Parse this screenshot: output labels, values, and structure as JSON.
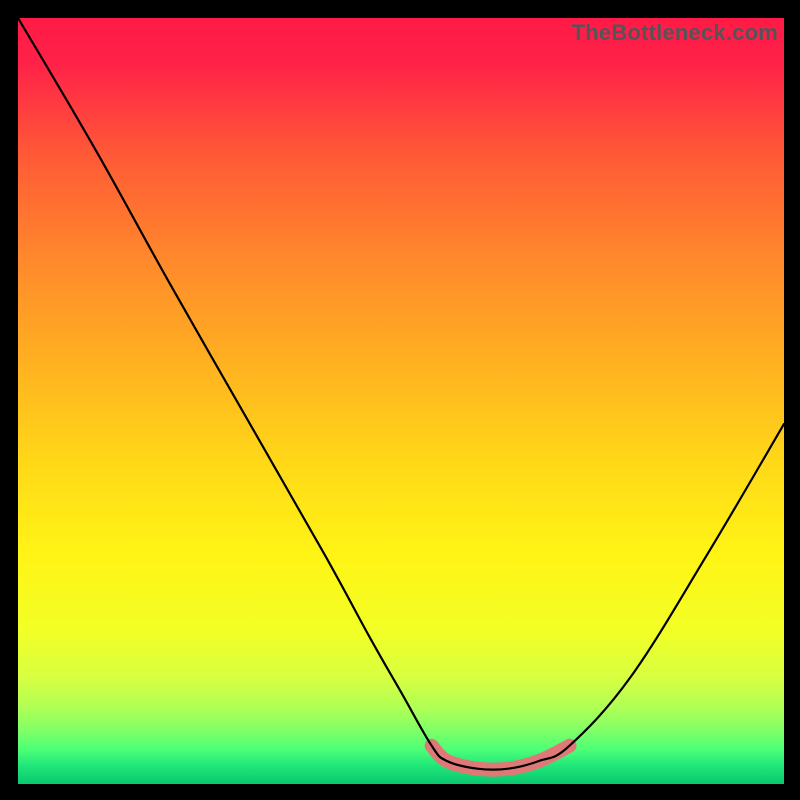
{
  "watermark": "TheBottleneck.com",
  "chart_data": {
    "type": "line",
    "title": "",
    "xlabel": "",
    "ylabel": "",
    "xlim": [
      0,
      100
    ],
    "ylim": [
      0,
      100
    ],
    "grid": false,
    "legend": false,
    "series": [
      {
        "name": "bottleneck-curve",
        "x": [
          0,
          10,
          20,
          30,
          40,
          46,
          50,
          54,
          56,
          60,
          64,
          68,
          72,
          80,
          90,
          100
        ],
        "values": [
          100,
          83,
          65,
          47.5,
          30,
          19,
          12,
          5,
          3,
          2,
          2,
          3,
          5,
          14,
          30,
          47
        ]
      },
      {
        "name": "highlight-range",
        "x": [
          54,
          56,
          60,
          64,
          68,
          72
        ],
        "values": [
          5,
          3,
          2,
          2,
          3,
          5
        ]
      }
    ],
    "gradient_stops": [
      {
        "pos": 0.0,
        "color": "#ff1a46"
      },
      {
        "pos": 0.06,
        "color": "#ff2248"
      },
      {
        "pos": 0.18,
        "color": "#ff5a36"
      },
      {
        "pos": 0.32,
        "color": "#ff8a2b"
      },
      {
        "pos": 0.46,
        "color": "#ffb420"
      },
      {
        "pos": 0.58,
        "color": "#ffd818"
      },
      {
        "pos": 0.7,
        "color": "#fff415"
      },
      {
        "pos": 0.8,
        "color": "#f2ff26"
      },
      {
        "pos": 0.86,
        "color": "#d8ff40"
      },
      {
        "pos": 0.9,
        "color": "#b0ff55"
      },
      {
        "pos": 0.93,
        "color": "#80ff66"
      },
      {
        "pos": 0.955,
        "color": "#4dff77"
      },
      {
        "pos": 0.975,
        "color": "#22e87a"
      },
      {
        "pos": 1.0,
        "color": "#08c86e"
      }
    ],
    "colors": {
      "curve": "#000000",
      "highlight": "#e07878"
    }
  }
}
